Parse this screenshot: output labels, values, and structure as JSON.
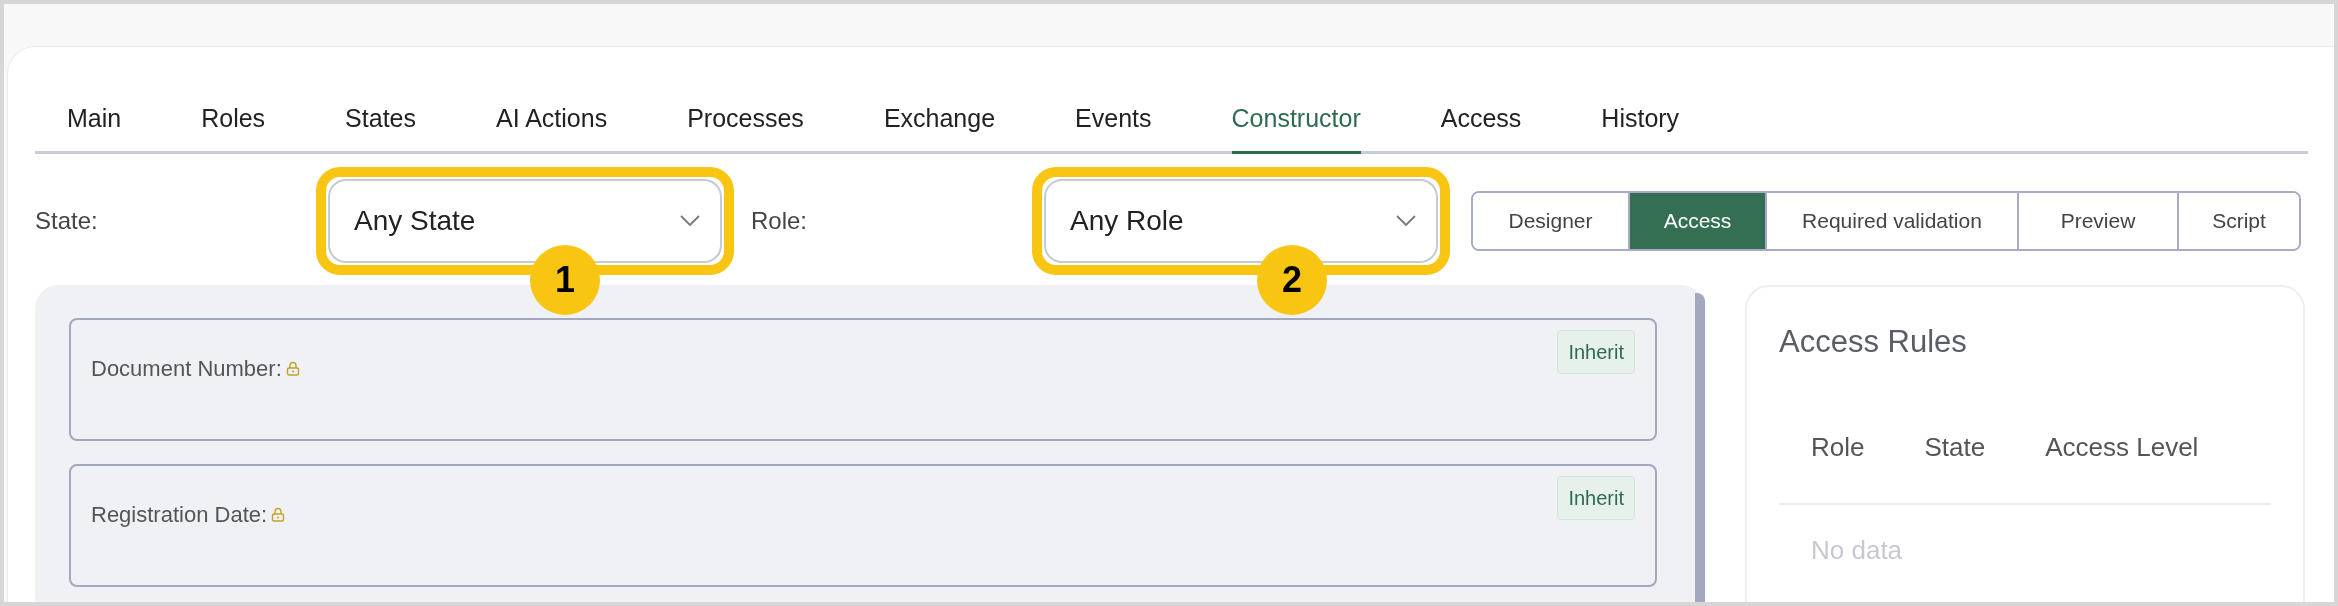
{
  "tabs": [
    {
      "label": "Main",
      "selected": false
    },
    {
      "label": "Roles",
      "selected": false
    },
    {
      "label": "States",
      "selected": false
    },
    {
      "label": "AI Actions",
      "selected": false
    },
    {
      "label": "Processes",
      "selected": false
    },
    {
      "label": "Exchange",
      "selected": false
    },
    {
      "label": "Events",
      "selected": false
    },
    {
      "label": "Constructor",
      "selected": true
    },
    {
      "label": "Access",
      "selected": false
    },
    {
      "label": "History",
      "selected": false
    }
  ],
  "filters": [
    {
      "label": "State:",
      "value": "Any State",
      "callout": "1"
    },
    {
      "label": "Role:",
      "value": "Any Role",
      "callout": "2"
    }
  ],
  "view_modes": [
    {
      "label": "Designer",
      "selected": false
    },
    {
      "label": "Access",
      "selected": true
    },
    {
      "label": "Required validation",
      "selected": false
    },
    {
      "label": "Preview",
      "selected": false
    },
    {
      "label": "Script",
      "selected": false
    }
  ],
  "fields": [
    {
      "label": "Document Number:",
      "locked": true,
      "badge": "Inherit"
    },
    {
      "label": "Registration Date:",
      "locked": true,
      "badge": "Inherit"
    }
  ],
  "access_rules": {
    "title": "Access Rules",
    "columns": [
      "Role",
      "State",
      "Access Level"
    ],
    "empty_text": "No data"
  }
}
